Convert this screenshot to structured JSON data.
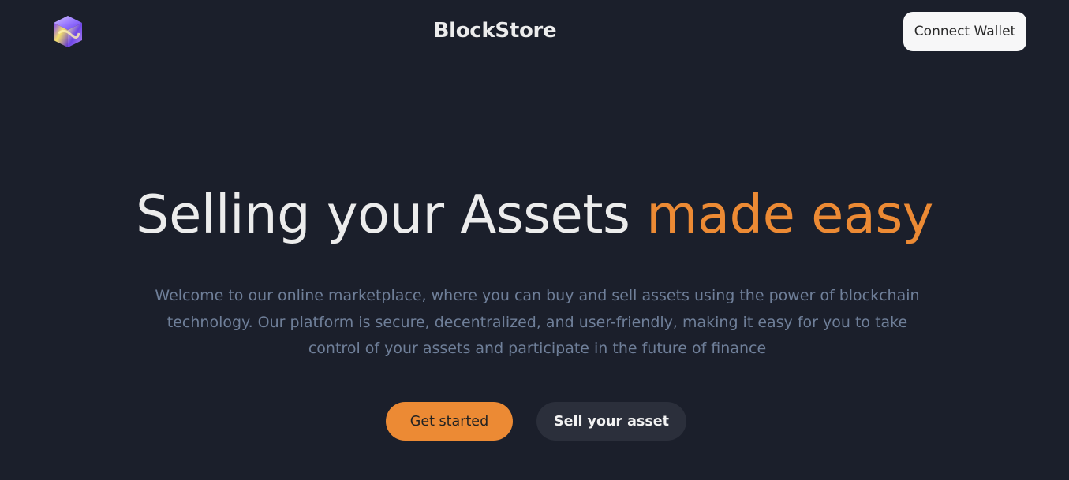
{
  "header": {
    "logo_icon": "cube-logo-icon",
    "brand_name": "BlockStore",
    "connect_wallet_label": "Connect Wallet"
  },
  "hero": {
    "headline_main": "Selling your Assets ",
    "headline_accent": "made easy",
    "description": "Welcome to our online marketplace, where you can buy and sell assets using the power of blockchain technology. Our platform is secure, decentralized, and user-friendly, making it easy for you to take control of your assets and participate in the future of finance",
    "primary_cta_label": "Get started",
    "secondary_cta_label": "Sell your asset"
  },
  "colors": {
    "background": "#1b1f2b",
    "accent": "#ec8a34",
    "text_primary": "#ececec",
    "text_muted": "#6f7f99",
    "button_light": "#f7f7f8",
    "button_dark": "#2b2f3b"
  }
}
